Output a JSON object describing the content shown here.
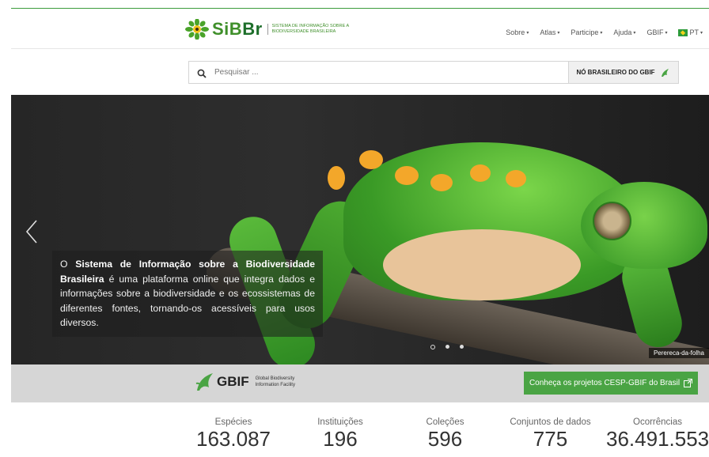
{
  "header": {
    "logo_text_a": "SiB",
    "logo_text_b": "Br",
    "logo_sub_line1": "Sistema de Informação sobre a",
    "logo_sub_line2": "Biodiversidade Brasileira",
    "nav": [
      {
        "label": "Sobre"
      },
      {
        "label": "Atlas"
      },
      {
        "label": "Participe"
      },
      {
        "label": "Ajuda"
      },
      {
        "label": "GBIF"
      },
      {
        "label": "PT"
      }
    ]
  },
  "search": {
    "placeholder": "Pesquisar ...",
    "button_label": "NÓ BRASILEIRO DO GBIF"
  },
  "hero": {
    "text_prefix": "O ",
    "text_bold": "Sistema de Informação sobre a Biodiversidade Brasileira",
    "text_rest": " é uma plataforma online que integra dados e informações sobre a biodiversidade e os ecossistemas de diferentes fontes, tornando-os acessíveis para usos diversos.",
    "caption": "Perereca-da-folha",
    "slides_total": 3,
    "active_slide": 1
  },
  "gbif": {
    "logo_text": "GBIF",
    "sub_line1": "Global Biodiversity",
    "sub_line2": "Information Facility",
    "button_label": "Conheça os projetos CESP-GBIF do Brasil"
  },
  "stats": [
    {
      "label": "Espécies",
      "value": "163.087"
    },
    {
      "label": "Instituições",
      "value": "196"
    },
    {
      "label": "Coleções",
      "value": "596"
    },
    {
      "label": "Conjuntos de dados",
      "value": "775"
    },
    {
      "label": "Ocorrências",
      "value": "36.491.553"
    }
  ],
  "colors": {
    "brand_green": "#3f8f2a",
    "gbif_button": "#4aa444"
  }
}
